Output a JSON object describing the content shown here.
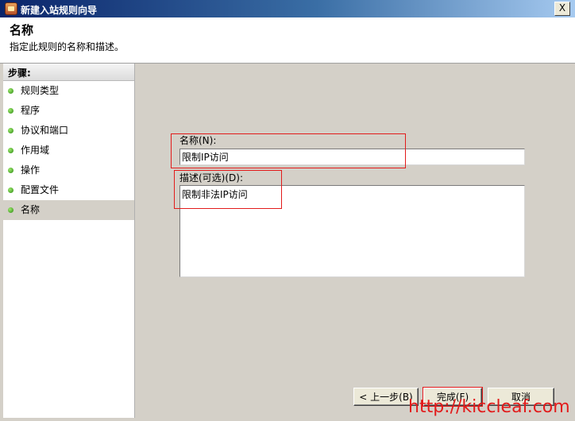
{
  "window": {
    "title": "新建入站规则向导",
    "close_label": "X"
  },
  "header": {
    "title": "名称",
    "subtitle": "指定此规则的名称和描述。"
  },
  "steps": {
    "heading": "步骤:",
    "items": [
      {
        "label": "规则类型"
      },
      {
        "label": "程序"
      },
      {
        "label": "协议和端口"
      },
      {
        "label": "作用域"
      },
      {
        "label": "操作"
      },
      {
        "label": "配置文件"
      },
      {
        "label": "名称",
        "active": true
      }
    ]
  },
  "form": {
    "name_label": "名称(N):",
    "name_value": "限制IP访问",
    "description_label": "描述(可选)(D):",
    "description_value": "限制非法IP访问"
  },
  "buttons": {
    "back": "< 上一步(B)",
    "finish": "完成(F)",
    "cancel": "取消"
  },
  "watermark": "http://kiccleaf.com",
  "colors": {
    "highlight_box": "#e21b1b",
    "title_bar": "#0a246a"
  }
}
